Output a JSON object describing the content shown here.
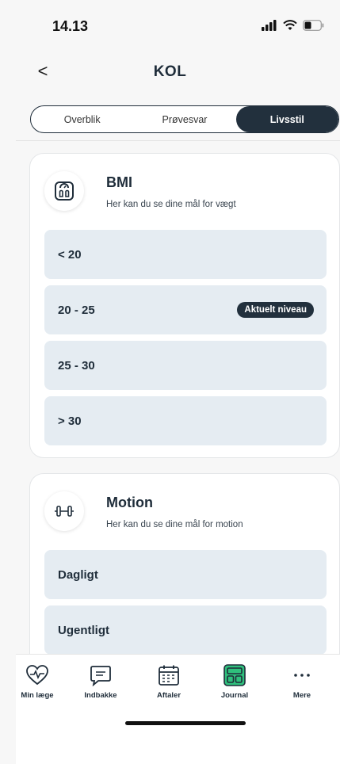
{
  "status": {
    "time": "14.13"
  },
  "header": {
    "back": "<",
    "title": "KOL"
  },
  "tabs": [
    {
      "label": "Overblik",
      "active": false
    },
    {
      "label": "Prøvesvar",
      "active": false
    },
    {
      "label": "Livsstil",
      "active": true
    }
  ],
  "bmi_card": {
    "icon": "scale-icon",
    "title": "BMI",
    "subtitle": "Her kan du se dine mål for vægt",
    "levels": [
      {
        "label": "< 20",
        "badge": ""
      },
      {
        "label": "20 - 25",
        "badge": "Aktuelt niveau"
      },
      {
        "label": "25 - 30",
        "badge": ""
      },
      {
        "label": "> 30",
        "badge": ""
      }
    ]
  },
  "motion_card": {
    "icon": "dumbbell-icon",
    "title": "Motion",
    "subtitle": "Her kan du se dine mål for motion",
    "levels": [
      {
        "label": "Dagligt"
      },
      {
        "label": "Ugentligt"
      }
    ]
  },
  "tabbar": {
    "items": [
      {
        "label": "Min læge",
        "icon": "heart-pulse-icon"
      },
      {
        "label": "Indbakke",
        "icon": "chat-icon"
      },
      {
        "label": "Aftaler",
        "icon": "calendar-icon"
      },
      {
        "label": "Journal",
        "icon": "journal-icon",
        "active": true
      },
      {
        "label": "Mere",
        "icon": "more-icon"
      }
    ]
  },
  "colors": {
    "accent": "#22303d",
    "row_bg": "#e5ecf2",
    "journal_green": "#2fc07c"
  }
}
